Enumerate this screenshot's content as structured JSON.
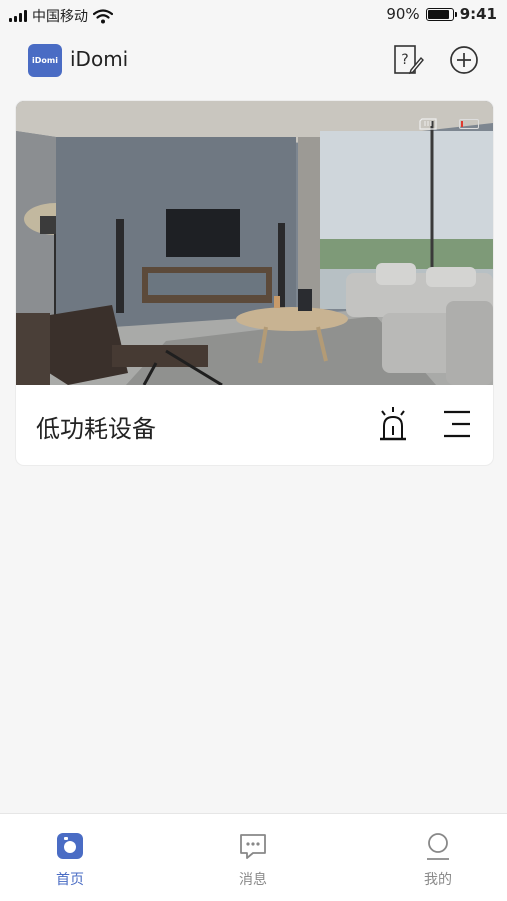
{
  "status_bar": {
    "carrier": "中国移动",
    "battery_percent": "90%",
    "battery_level": 0.9,
    "time": "9:41"
  },
  "header": {
    "logo_text": "iDomi",
    "title": "iDomi",
    "help_icon": "help-edit-icon",
    "add_icon": "plus-circle-icon"
  },
  "device_card": {
    "name": "低功耗设备",
    "image_icons": [
      "sd-card-icon",
      "battery-low-icon"
    ],
    "device_battery_level": 0.15,
    "actions": [
      "alarm-icon",
      "menu-icon"
    ]
  },
  "tab_bar": {
    "tabs": [
      {
        "label": "首页",
        "icon": "home-icon",
        "active": true
      },
      {
        "label": "消息",
        "icon": "message-icon",
        "active": false
      },
      {
        "label": "我的",
        "icon": "user-icon",
        "active": false
      }
    ]
  },
  "colors": {
    "accent": "#4a6cc4",
    "battery_low": "#e03a2f",
    "background": "#f6f6f6"
  }
}
